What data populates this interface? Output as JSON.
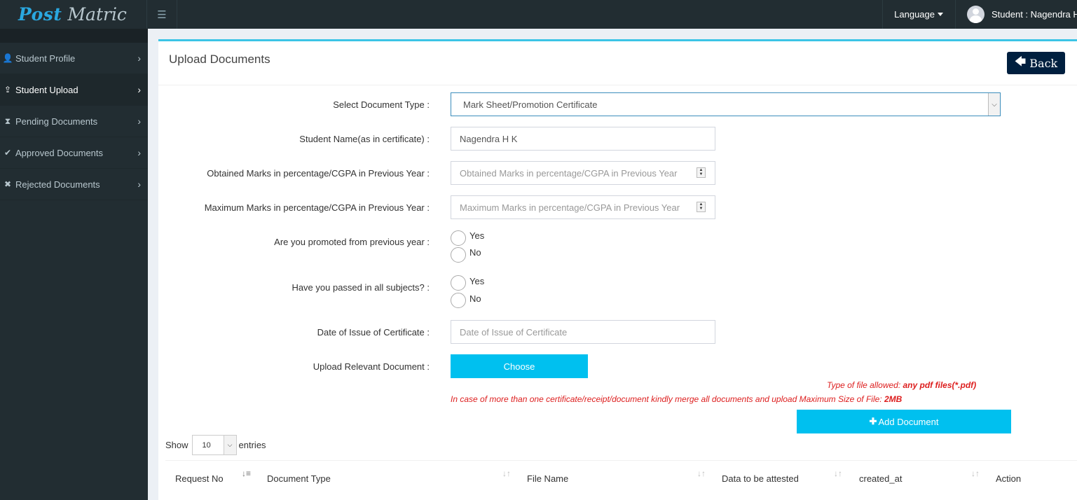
{
  "brand": {
    "part1": "Post",
    "part2": "Matric"
  },
  "topbar": {
    "menu_icon": "hamburger-icon",
    "language_label": "Language",
    "user_label": "Student : Nagendra H"
  },
  "sidebar": {
    "items": [
      {
        "label": "Student Profile",
        "icon": "user-icon",
        "glyph": "👤"
      },
      {
        "label": "Student Upload",
        "icon": "upload-icon",
        "glyph": "⇪"
      },
      {
        "label": "Pending Documents",
        "icon": "hourglass-icon",
        "glyph": "⧗"
      },
      {
        "label": "Approved Documents",
        "icon": "check-icon",
        "glyph": "✔"
      },
      {
        "label": "Rejected Documents",
        "icon": "x-icon",
        "glyph": "✖"
      }
    ],
    "chevron": "›"
  },
  "page": {
    "title": "Upload Documents",
    "back_label": "Back"
  },
  "form": {
    "doc_type_label": "Select Document Type :",
    "doc_type_value": "Mark Sheet/Promotion Certificate",
    "student_name_label": "Student Name(as in certificate) :",
    "student_name_value": "Nagendra H K",
    "obtained_label": "Obtained Marks in percentage/CGPA in Previous Year :",
    "obtained_placeholder": "Obtained Marks in percentage/CGPA in Previous Year",
    "maximum_label": "Maximum Marks in percentage/CGPA in Previous Year :",
    "maximum_placeholder": "Maximum Marks in percentage/CGPA in Previous Year",
    "promoted_label": "Are you promoted from previous year :",
    "passed_label": "Have you passed in all subjects? :",
    "yes": "Yes",
    "no": "No",
    "date_label": "Date of Issue of Certificate :",
    "date_placeholder": "Date of Issue of Certificate",
    "upload_label": "Upload Relevant Document :",
    "choose_label": "Choose",
    "note1_prefix": "Type of file allowed: ",
    "note1_bold": "any pdf files(*.pdf)",
    "note2_prefix": "In case of more than one certificate/receipt/document kindly merge all documents and upload Maximum Size of File: ",
    "note2_bold": "2MB",
    "add_label": "Add Document"
  },
  "table": {
    "show_label": "Show",
    "entries_value": "10",
    "entries_label": "entries",
    "columns": [
      "Request No",
      "Document Type",
      "File Name",
      "Data to be attested",
      "created_at",
      "Action"
    ]
  },
  "colors": {
    "sidebar_bg": "#222d32",
    "accent": "#00c0ef",
    "back_button": "#001f3f",
    "note_red": "#dd1e1e"
  }
}
